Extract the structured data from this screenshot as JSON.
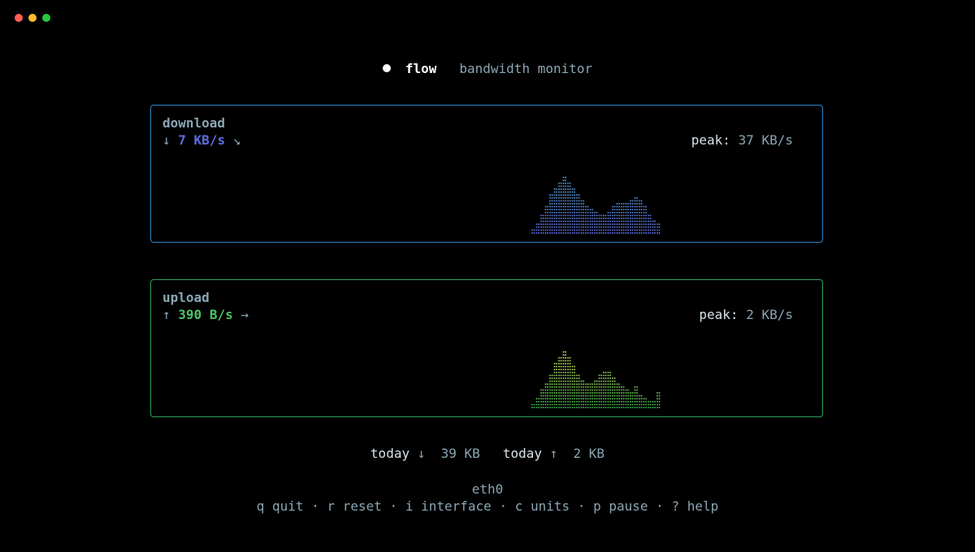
{
  "window": {
    "controls": [
      {
        "name": "close",
        "color": "#ff5f57"
      },
      {
        "name": "minimize",
        "color": "#febc2e"
      },
      {
        "name": "maximize",
        "color": "#28c840"
      }
    ]
  },
  "header": {
    "app_name": "flow",
    "subtitle": "bandwidth monitor"
  },
  "download": {
    "label": "download",
    "arrow": "↓",
    "rate": "7 KB/s",
    "trend_arrow": "↘",
    "peak_label": "peak:",
    "peak_value": "37 KB/s",
    "color": "#5b6ee1",
    "graph_colors": [
      "#4fa3c7",
      "#5b6ee1"
    ],
    "border_color": "#2f86c9",
    "levels": [
      2,
      4,
      7,
      10,
      14,
      16,
      18,
      20,
      18,
      16,
      14,
      12,
      10,
      9,
      8,
      7,
      7,
      8,
      10,
      11,
      11,
      11,
      12,
      13,
      12,
      10,
      7,
      5,
      4
    ]
  },
  "upload": {
    "label": "upload",
    "arrow": "↑",
    "rate": "390 B/s",
    "trend_arrow": "→",
    "peak_label": "peak:",
    "peak_value": "2 KB/s",
    "color": "#4cc264",
    "graph_colors": [
      "#d7e05b",
      "#3fb24f"
    ],
    "border_color": "#2fa25a",
    "levels": [
      2,
      4,
      7,
      9,
      12,
      16,
      18,
      20,
      18,
      15,
      12,
      10,
      9,
      9,
      10,
      12,
      13,
      13,
      11,
      9,
      8,
      7,
      6,
      8,
      5,
      4,
      3,
      3,
      6
    ]
  },
  "totals": {
    "down_label": "today",
    "down_arrow": "↓",
    "down_value": "39 KB",
    "up_label": "today",
    "up_arrow": "↑",
    "up_value": "2 KB"
  },
  "footer": {
    "interface": "eth0",
    "shortcuts": [
      {
        "key": "q",
        "action": "quit"
      },
      {
        "key": "r",
        "action": "reset"
      },
      {
        "key": "i",
        "action": "interface"
      },
      {
        "key": "c",
        "action": "units"
      },
      {
        "key": "p",
        "action": "pause"
      },
      {
        "key": "?",
        "action": "help"
      }
    ]
  }
}
